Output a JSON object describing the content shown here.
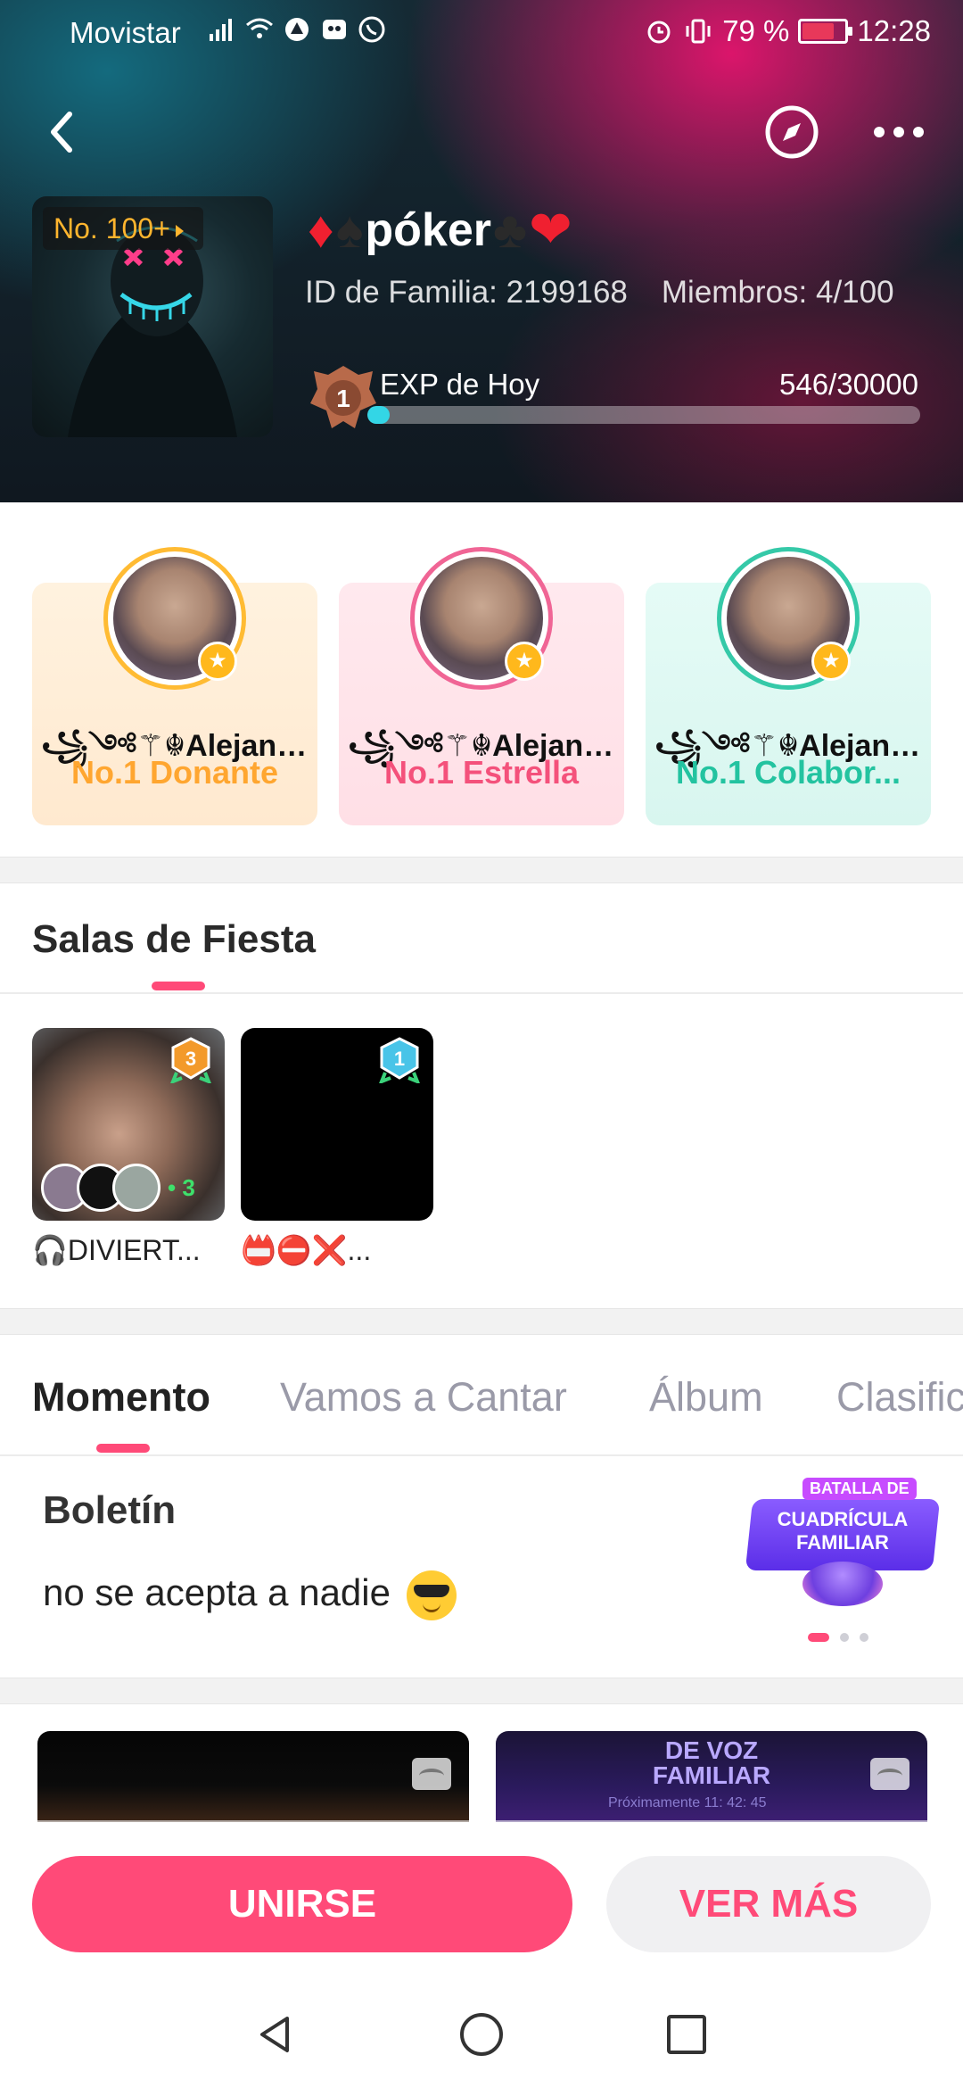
{
  "status_bar": {
    "carrier": "Movistar",
    "battery": "79 %",
    "time": "12:28",
    "left_icons": [
      "signal-icon",
      "wifi-icon",
      "app-icon",
      "app-icon",
      "whatsapp-icon"
    ],
    "right_icons": [
      "alarm-icon",
      "vibrate-icon",
      "battery-icon"
    ]
  },
  "family": {
    "rank_tag": "No. 100+",
    "name": "póker",
    "suits_left": [
      "♦",
      "♠"
    ],
    "suits_right": [
      "♣",
      "❤"
    ],
    "id_label": "ID de Familia: 2199168",
    "members_label": "Miembros: 4/100",
    "exp_label": "EXP de Hoy",
    "exp_value": "546/30000",
    "exp_fraction": 0.0182,
    "level_badge": "1"
  },
  "top_members": [
    {
      "name": "꧁༺⚚☬Alejand�...",
      "role": "No.1 Donante",
      "accent": "#ffa630"
    },
    {
      "name": "꧁༺⚚☬Alejand�...",
      "role": "No.1 Estrella",
      "accent": "#f4517b"
    },
    {
      "name": "꧁༺⚚☬Alejand�...",
      "role": "No.1 Colabor...",
      "accent": "#23c3a0"
    }
  ],
  "party_rooms": {
    "title": "Salas de Fiesta",
    "rooms": [
      {
        "name": "🎧DIVIERT...",
        "level": "3",
        "member_count": "3"
      },
      {
        "name": "📛⛔❌...",
        "level": "1"
      }
    ]
  },
  "tabs": [
    "Momento",
    "Vamos a Cantar",
    "Álbum",
    "Clasific"
  ],
  "bulletin": {
    "title": "Boletín",
    "text": "no se acepta a nadie"
  },
  "banner": {
    "line1": "BATALLA DE",
    "line2": "CUADRÍCULA FAMILIAR"
  },
  "media_preview": {
    "banner_line1": "DE VOZ",
    "banner_line2": "FAMILIAR",
    "meta": "Próximamente 11: 42: 45"
  },
  "actions": {
    "join": "UNIRSE",
    "more": "VER MÁS"
  },
  "colors": {
    "accent": "#ff4a78",
    "exp_bar": "#33d6e6"
  }
}
